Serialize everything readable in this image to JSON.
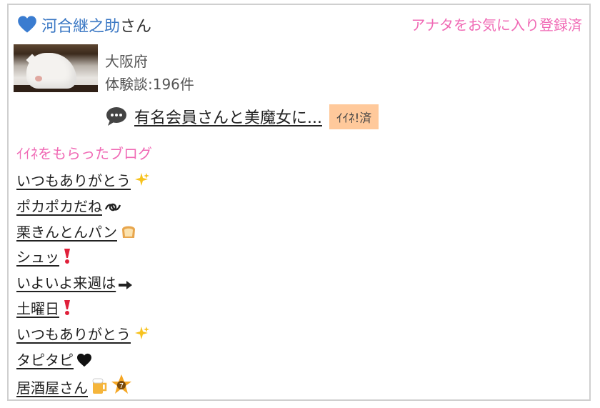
{
  "header": {
    "user_name": "河合継之助",
    "honorific": "さん",
    "favorite_status": "アナタをお気に入り登録済"
  },
  "profile": {
    "region": "大阪府",
    "experience_count": "体験談:196件"
  },
  "entry": {
    "title": "有名会員さんと美魔女に...",
    "iine_badge": "ｲｲﾈ!済"
  },
  "liked_blogs": {
    "section_title": "ｲｲﾈをもらったブログ",
    "items": [
      {
        "label": "いつもありがとう",
        "icon": "sparkles-icon"
      },
      {
        "label": "ポカポカだね",
        "icon": "curly-loop-icon"
      },
      {
        "label": "栗きんとんパン",
        "icon": "bread-icon"
      },
      {
        "label": "シュッ",
        "icon": "exclamation-icon"
      },
      {
        "label": "いよいよ来週は",
        "icon": "right-arrow-icon"
      },
      {
        "label": "土曜日",
        "icon": "exclamation-icon"
      },
      {
        "label": "いつもありがとう",
        "icon": "sparkles-icon"
      },
      {
        "label": "タピタピ",
        "icon": "black-heart-icon"
      },
      {
        "label": "居酒屋さん",
        "icon": "beer-star-icon"
      }
    ]
  },
  "colors": {
    "accent_pink": "#f06ab5",
    "link_blue": "#3b78c4",
    "badge_orange": "#ffc99b"
  }
}
